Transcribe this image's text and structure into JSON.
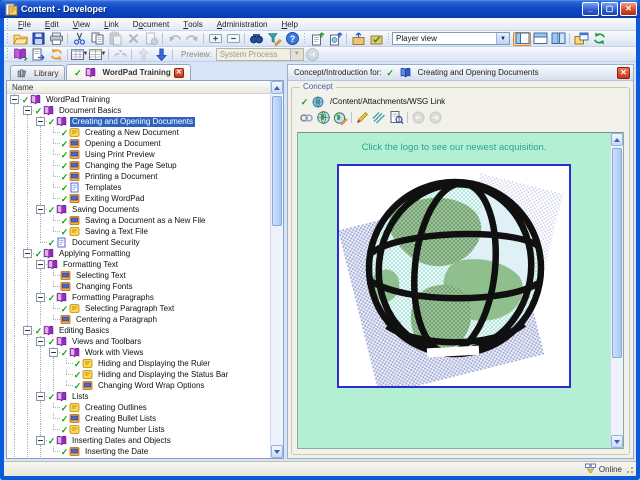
{
  "window": {
    "title": "Content - Developer"
  },
  "menu": {
    "items": [
      {
        "label": "File",
        "u": 0
      },
      {
        "label": "Edit",
        "u": 0
      },
      {
        "label": "View",
        "u": 0
      },
      {
        "label": "Link",
        "u": 0
      },
      {
        "label": "Document",
        "u": 1
      },
      {
        "label": "Tools",
        "u": 0
      },
      {
        "label": "Administration",
        "u": 0
      },
      {
        "label": "Help",
        "u": 0
      }
    ]
  },
  "toolbar_row1": {
    "groups": [
      [
        {
          "icon": "open"
        },
        {
          "icon": "save"
        },
        {
          "icon": "print"
        }
      ],
      [
        {
          "icon": "cut"
        },
        {
          "icon": "copy"
        },
        {
          "icon": "paste",
          "disabled": true
        },
        {
          "icon": "delete",
          "disabled": true
        },
        {
          "icon": "view-doc",
          "disabled": true
        }
      ],
      [
        {
          "icon": "undo",
          "disabled": true
        },
        {
          "icon": "redo",
          "disabled": true
        }
      ],
      [
        {
          "icon": "expand-all"
        },
        {
          "icon": "collapse-all"
        }
      ],
      [
        {
          "icon": "find"
        },
        {
          "icon": "find-advanced"
        },
        {
          "icon": "help"
        }
      ]
    ],
    "groups_b": [
      [
        {
          "icon": "doc-export"
        },
        {
          "icon": "doc-export-web"
        }
      ],
      [
        {
          "icon": "package-up"
        },
        {
          "icon": "package-check"
        }
      ]
    ],
    "combo_value": "Player view",
    "view_buttons": [
      {
        "icon": "layout-left",
        "active": true
      },
      {
        "icon": "layout-rows"
      },
      {
        "icon": "layout-cols"
      }
    ],
    "tail_buttons": [
      {
        "icon": "new-window"
      },
      {
        "icon": "refresh"
      }
    ]
  },
  "toolbar_row2": {
    "groups": [
      [
        {
          "icon": "book-export"
        },
        {
          "icon": "doc-arrow"
        },
        {
          "icon": "sync"
        }
      ],
      [
        {
          "icon": "grid-view",
          "dropdown": true
        },
        {
          "icon": "grid-view2",
          "dropdown": true
        }
      ],
      [
        {
          "icon": "link-broken",
          "disabled": true
        }
      ],
      [
        {
          "icon": "move-up",
          "disabled": true
        },
        {
          "icon": "move-down"
        }
      ]
    ],
    "preview_label": "Preview:",
    "preview_value": "System Process",
    "tail": [
      {
        "icon": "go",
        "disabled": true
      }
    ]
  },
  "tabs": [
    {
      "label": "Library",
      "icon": "library",
      "active": false,
      "checked": false,
      "closable": false
    },
    {
      "label": "WordPad Training",
      "icon": "book",
      "active": true,
      "checked": true,
      "closable": true
    }
  ],
  "tree": {
    "header": "Name",
    "items": [
      {
        "depth": 0,
        "icon": "book",
        "checked": true,
        "expandable": true,
        "label": "WordPad Training"
      },
      {
        "depth": 1,
        "icon": "book",
        "checked": true,
        "expandable": true,
        "label": "Document Basics"
      },
      {
        "depth": 2,
        "icon": "book",
        "checked": true,
        "expandable": true,
        "selected": true,
        "label": "Creating and Opening Documents"
      },
      {
        "depth": 3,
        "icon": "topic-yellow",
        "checked": true,
        "label": "Creating a New Document"
      },
      {
        "depth": 3,
        "icon": "topic-orange",
        "checked": true,
        "label": "Opening a Document"
      },
      {
        "depth": 3,
        "icon": "topic-orange",
        "checked": true,
        "label": "Using Print Preview"
      },
      {
        "depth": 3,
        "icon": "topic-orange",
        "checked": true,
        "label": "Changing the Page Setup"
      },
      {
        "depth": 3,
        "icon": "topic-orange",
        "checked": true,
        "label": "Printing a Document"
      },
      {
        "depth": 3,
        "icon": "page-blue",
        "checked": true,
        "label": "Templates"
      },
      {
        "depth": 3,
        "icon": "topic-orange",
        "checked": true,
        "label": "Exiting WordPad"
      },
      {
        "depth": 2,
        "icon": "book",
        "checked": true,
        "expandable": true,
        "label": "Saving Documents"
      },
      {
        "depth": 3,
        "icon": "topic-orange",
        "checked": true,
        "label": "Saving a Document as a New File"
      },
      {
        "depth": 3,
        "icon": "topic-yellow",
        "checked": true,
        "label": "Saving a Text File"
      },
      {
        "depth": 2,
        "icon": "page-blue",
        "checked": true,
        "label": "Document Security"
      },
      {
        "depth": 1,
        "icon": "book",
        "checked": true,
        "expandable": true,
        "label": "Applying Formatting"
      },
      {
        "depth": 2,
        "icon": "book",
        "checked": false,
        "expandable": true,
        "label": "Formatting Text"
      },
      {
        "depth": 3,
        "icon": "topic-orange",
        "checked": false,
        "label": "Selecting Text"
      },
      {
        "depth": 3,
        "icon": "topic-orange",
        "checked": false,
        "label": "Changing Fonts"
      },
      {
        "depth": 2,
        "icon": "book",
        "checked": true,
        "expandable": true,
        "label": "Formatting Paragraphs"
      },
      {
        "depth": 3,
        "icon": "topic-yellow",
        "checked": true,
        "label": "Selecting Paragraph Text"
      },
      {
        "depth": 3,
        "icon": "topic-orange",
        "checked": false,
        "label": "Centering a Paragraph"
      },
      {
        "depth": 1,
        "icon": "book",
        "checked": true,
        "expandable": true,
        "label": "Editing Basics"
      },
      {
        "depth": 2,
        "icon": "book",
        "checked": true,
        "expandable": true,
        "label": "Views and Toolbars"
      },
      {
        "depth": 3,
        "icon": "book",
        "checked": true,
        "expandable": true,
        "label": "Work with Views"
      },
      {
        "depth": 4,
        "icon": "topic-yellow",
        "checked": true,
        "label": "Hiding and Displaying the Ruler"
      },
      {
        "depth": 4,
        "icon": "topic-yellow",
        "checked": true,
        "label": "Hiding and Displaying the Status Bar"
      },
      {
        "depth": 4,
        "icon": "topic-orange",
        "checked": true,
        "label": "Changing Word Wrap Options"
      },
      {
        "depth": 2,
        "icon": "book",
        "checked": true,
        "expandable": true,
        "label": "Lists"
      },
      {
        "depth": 3,
        "icon": "topic-yellow",
        "checked": true,
        "label": "Creating Outlines"
      },
      {
        "depth": 3,
        "icon": "topic-orange",
        "checked": true,
        "label": "Creating Bullet Lists"
      },
      {
        "depth": 3,
        "icon": "topic-yellow",
        "checked": true,
        "label": "Creating Number Lists"
      },
      {
        "depth": 2,
        "icon": "book",
        "checked": true,
        "expandable": true,
        "label": "Inserting Dates and Objects"
      },
      {
        "depth": 3,
        "icon": "topic-orange",
        "checked": true,
        "label": "Inserting the Date"
      }
    ]
  },
  "right_panel": {
    "title_label": "Concept/Introduction for:",
    "title_target": "Creating and Opening Documents",
    "groupbox_label": "Concept",
    "link_path": "/Content/Attachments/WSG Link",
    "toolbar": [
      [
        {
          "icon": "link"
        },
        {
          "icon": "web"
        },
        {
          "icon": "web-edit"
        }
      ],
      [
        {
          "icon": "pencil"
        },
        {
          "icon": "clear"
        },
        {
          "icon": "preview-doc"
        }
      ],
      [
        {
          "icon": "nav-back",
          "disabled": true
        },
        {
          "icon": "nav-forward",
          "disabled": true
        }
      ]
    ],
    "content_caption": "Click the logo to see our newest acquisition."
  },
  "status_bar": {
    "online_label": "Online"
  },
  "colors": {
    "frame_blue": "#0a5bdc",
    "selection_blue": "#2f62c0",
    "check_green": "#10a410",
    "content_mint": "#b3f0d3",
    "caption_teal": "#2ba399",
    "globe_border": "#2b2bd0",
    "tab_close_red": "#cc3318"
  }
}
